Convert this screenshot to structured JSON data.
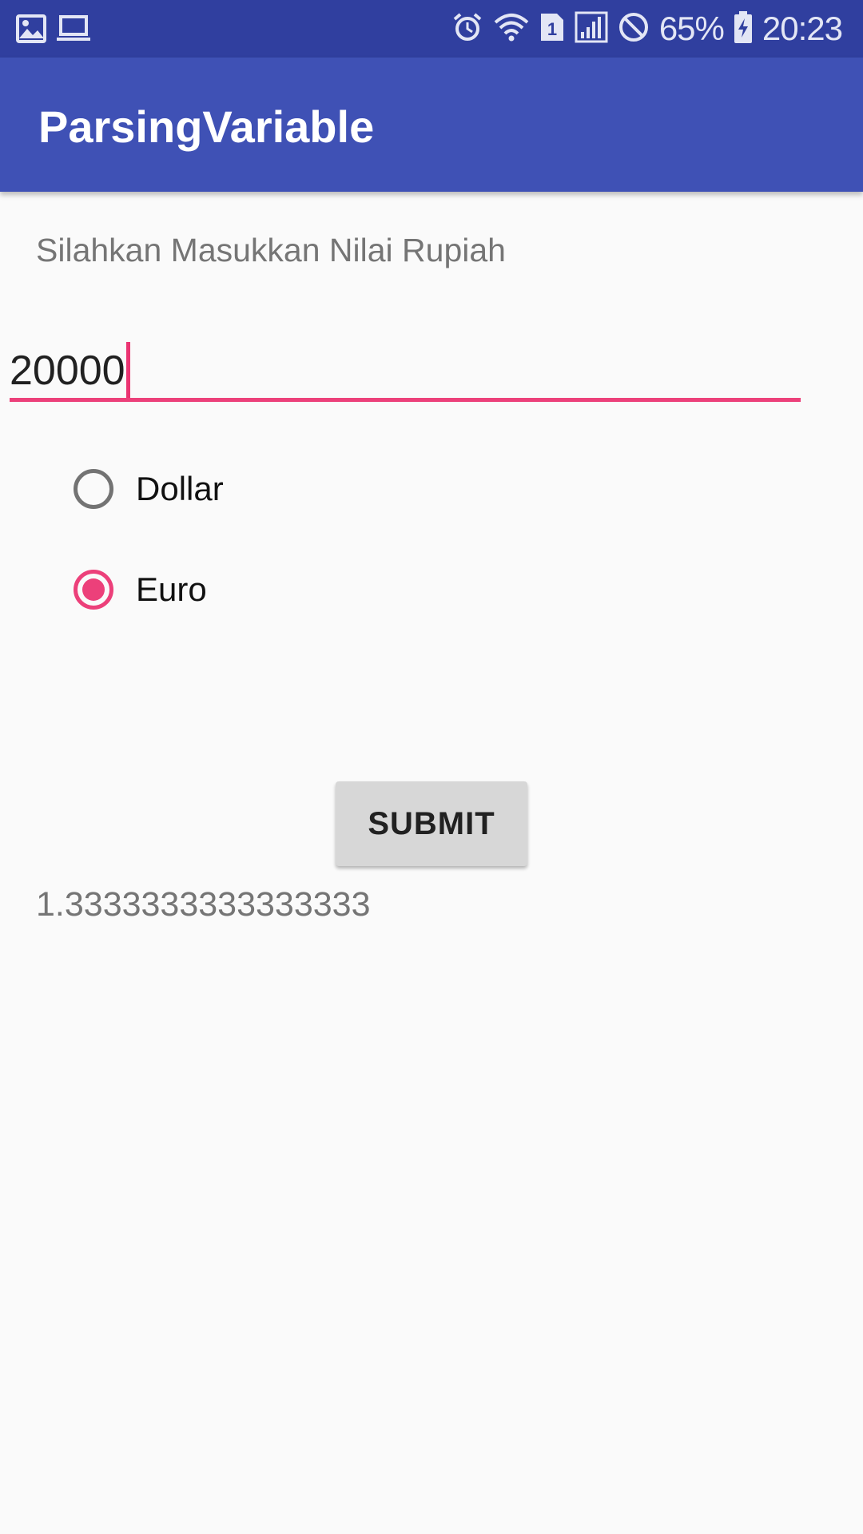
{
  "status_bar": {
    "left_icons": [
      "gallery-icon",
      "laptop-icon"
    ],
    "right_icons": [
      "alarm-icon",
      "wifi-icon",
      "sim-1-icon",
      "signal-icon",
      "do-not-disturb-icon",
      "battery-charging-icon"
    ],
    "battery_percent": "65%",
    "time": "20:23",
    "background_color": "#303f9f"
  },
  "app_bar": {
    "title": "ParsingVariable",
    "background_color": "#3f51b5"
  },
  "form": {
    "prompt": "Silahkan Masukkan Nilai Rupiah",
    "amount_value": "20000",
    "accent_color": "#ec407a",
    "options": [
      {
        "label": "Dollar",
        "selected": false
      },
      {
        "label": "Euro",
        "selected": true
      }
    ],
    "submit_label": "SUBMIT",
    "result": "1.3333333333333333"
  }
}
